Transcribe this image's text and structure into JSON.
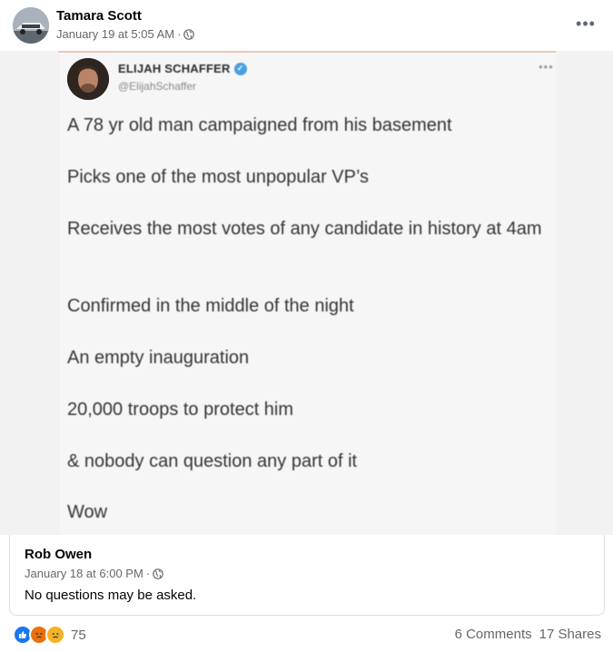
{
  "post": {
    "author": "Tamara Scott",
    "timestamp": "January 19 at 5:05 AM",
    "separator": "·",
    "audience_icon": "globe-icon",
    "more_icon": "•••"
  },
  "tweet": {
    "name": "ELIJAH SCHAFFER",
    "handle": "@ElijahSchaffer",
    "more": "•••",
    "lines": [
      "A 78 yr old man campaigned from his basement",
      "Picks one of the most unpopular VP’s",
      "Receives the most votes of any candidate in history at 4am",
      "Confirmed in the middle of the night",
      "An empty inauguration",
      "20,000 troops to protect him",
      "& nobody can question any part of it",
      "Wow"
    ]
  },
  "comment": {
    "author": "Rob Owen",
    "timestamp": "January 18 at 6:00 PM",
    "separator": "·",
    "body": "No questions may be asked."
  },
  "footer": {
    "reaction_count": "75",
    "comments": "6 Comments",
    "shares": "17 Shares"
  },
  "colors": {
    "accent": "#1877f2",
    "muted_text": "#65676b"
  }
}
